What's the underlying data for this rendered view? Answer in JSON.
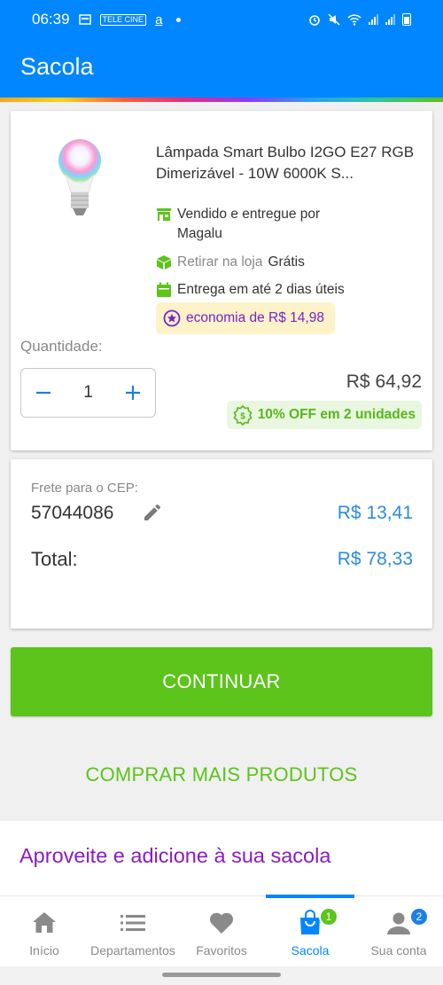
{
  "status_bar": {
    "time": "06:39",
    "tele_cine": "TELE CINE",
    "a_label": "a"
  },
  "header": {
    "title": "Sacola"
  },
  "product": {
    "name": "Lâmpada Smart Bulbo I2GO E27 RGB Dimerizável - 10W 6000K S...",
    "seller": "Vendido e entregue por Magalu",
    "pickup_label": "Retirar na loja",
    "pickup_price": "Grátis",
    "delivery": "Entrega em até 2 dias úteis",
    "economy": "economia de R$ 14,98",
    "quantity_label": "Quantidade:",
    "quantity": "1",
    "minus_symbol": "−",
    "plus_symbol": "+",
    "price": "R$ 64,92",
    "promo": "10% OFF em 2 unidades"
  },
  "freight": {
    "cep_label": "Frete para o CEP:",
    "cep": "57044086",
    "price": "R$ 13,41",
    "total_label": "Total:",
    "total": "R$ 78,33"
  },
  "actions": {
    "continue": "CONTINUAR",
    "buy_more": "COMPRAR MAIS PRODUTOS"
  },
  "suggestions": {
    "title": "Aproveite e adicione à sua sacola"
  },
  "bottom_nav": {
    "items": [
      {
        "label": "Início",
        "icon": "home-icon"
      },
      {
        "label": "Departamentos",
        "icon": "list-icon"
      },
      {
        "label": "Favoritos",
        "icon": "heart-icon"
      },
      {
        "label": "Sacola",
        "icon": "bag-icon",
        "badge": "1",
        "active": true
      },
      {
        "label": "Sua conta",
        "icon": "user-icon",
        "badge": "2"
      }
    ]
  },
  "colors": {
    "brand_blue": "#0086ff",
    "green": "#5cc41a",
    "purple": "#8a1cc4",
    "price_blue": "#2b8de0"
  }
}
